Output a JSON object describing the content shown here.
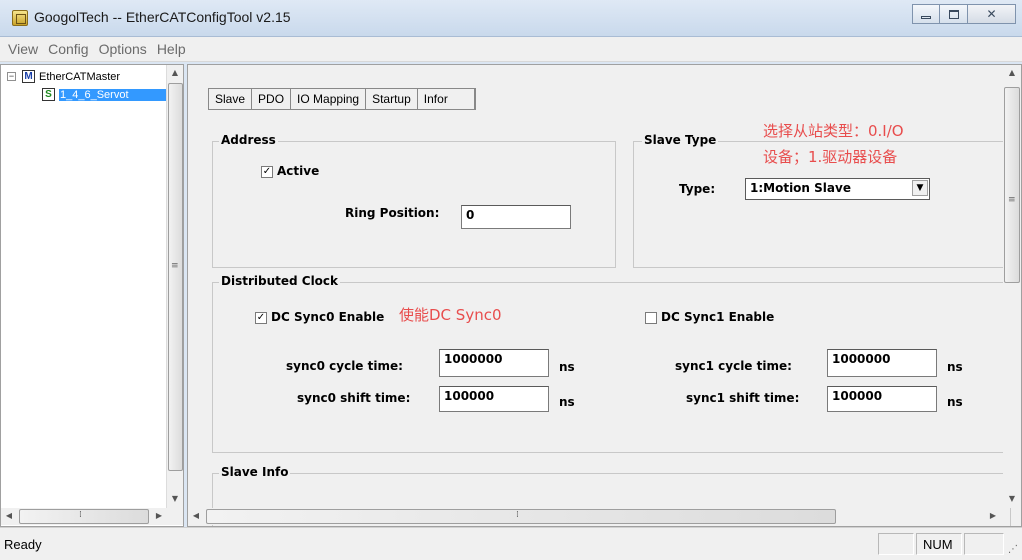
{
  "window": {
    "title": "GoogolTech -- EtherCATConfigTool v2.15"
  },
  "menu": [
    "View",
    "Config",
    "Options",
    "Help"
  ],
  "tree": {
    "root": {
      "icon_letter": "M",
      "label": "EtherCATMaster",
      "expander": "−"
    },
    "child": {
      "icon_letter": "S",
      "label": "1_4_6_Servot"
    }
  },
  "tabs": [
    "Slave",
    "PDO",
    "IO Mapping",
    "Startup",
    "Infor"
  ],
  "address": {
    "title": "Address",
    "active_label": "Active",
    "active_checked": "✓",
    "ring_position_label": "Ring Position:",
    "ring_position_value": "0"
  },
  "slave_type": {
    "title": "Slave Type",
    "type_label": "Type:",
    "type_value": "1:Motion Slave",
    "annotation_line1": "选择从站类型：0.I/O",
    "annotation_line2": "设备；1.驱动器设备"
  },
  "dc": {
    "title": "Distributed Clock",
    "sync0_enable_label": "DC Sync0 Enable",
    "sync0_checked": "✓",
    "sync0_annotation": "使能DC Sync0",
    "sync1_enable_label": "DC Sync1 Enable",
    "sync0_cycle_label": "sync0 cycle time:",
    "sync0_cycle_value": "1000000",
    "sync0_shift_label": "sync0 shift time:",
    "sync0_shift_value": "100000",
    "sync1_cycle_label": "sync1 cycle time:",
    "sync1_cycle_value": "1000000",
    "sync1_shift_label": "sync1 shift time:",
    "sync1_shift_value": "100000",
    "unit": "ns"
  },
  "slave_info": {
    "title": "Slave Info"
  },
  "status": {
    "text": "Ready",
    "num": "NUM"
  },
  "colors": {
    "annotation": "#e84d4d",
    "selection": "#3399ff"
  }
}
